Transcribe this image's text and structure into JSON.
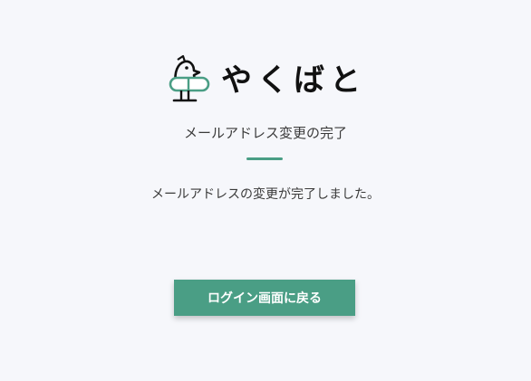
{
  "logo": {
    "text": "やくばと",
    "icon": "pigeon-capsule-icon",
    "accent_color": "#4a9e85"
  },
  "page": {
    "title": "メールアドレス変更の完了",
    "message": "メールアドレスの変更が完了しました。"
  },
  "actions": {
    "back_to_login_label": "ログイン画面に戻る"
  },
  "colors": {
    "background": "#f6f7fb",
    "accent": "#4a9e85",
    "text": "#333333"
  }
}
